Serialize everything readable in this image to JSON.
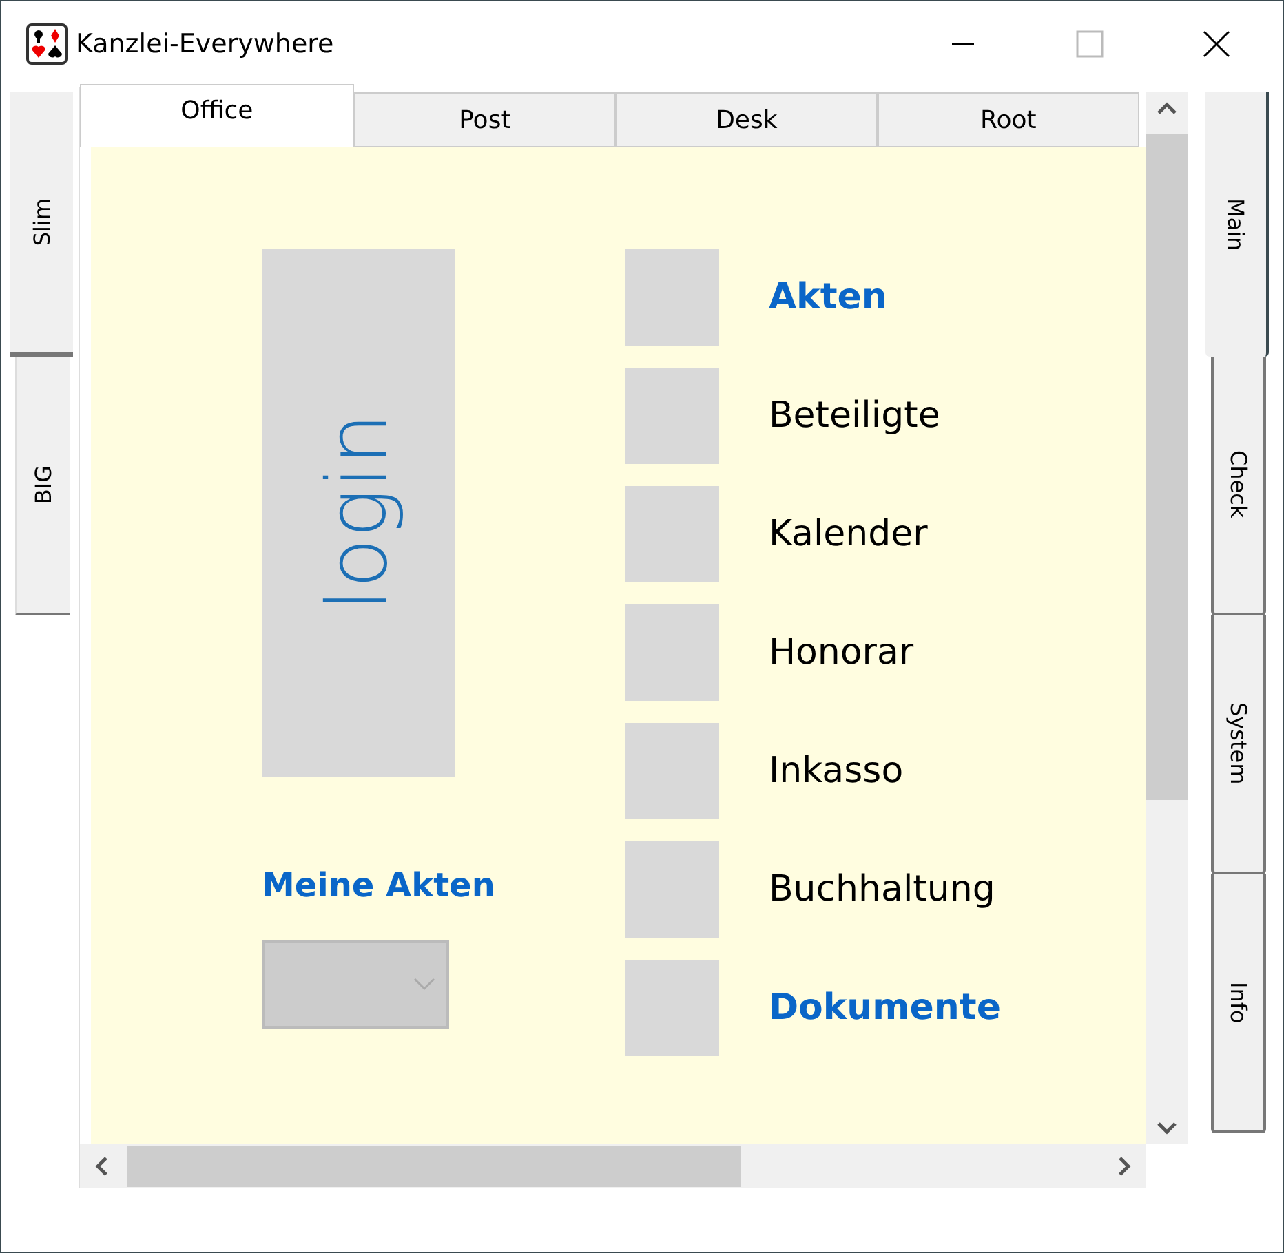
{
  "window": {
    "title": "Kanzlei-Everywhere"
  },
  "left_tabs": [
    {
      "label": "Slim",
      "selected": true
    },
    {
      "label": "BIG",
      "selected": false
    }
  ],
  "right_tabs": [
    {
      "label": "Main",
      "selected": true
    },
    {
      "label": "Check",
      "selected": false
    },
    {
      "label": "System",
      "selected": false
    },
    {
      "label": "Info",
      "selected": false
    }
  ],
  "tabs": [
    {
      "label": "Office",
      "selected": true
    },
    {
      "label": "Post",
      "selected": false
    },
    {
      "label": "Desk",
      "selected": false
    },
    {
      "label": "Root",
      "selected": false
    }
  ],
  "login_button": {
    "label": "login"
  },
  "my_files": {
    "label": "Meine Akten",
    "dropdown": {
      "disabled": true
    }
  },
  "menu": [
    {
      "label": "Akten",
      "highlighted": true
    },
    {
      "label": "Beteiligte",
      "highlighted": false
    },
    {
      "label": "Kalender",
      "highlighted": false
    },
    {
      "label": "Honorar",
      "highlighted": false
    },
    {
      "label": "Inkasso",
      "highlighted": false
    },
    {
      "label": "Buchhaltung",
      "highlighted": false
    },
    {
      "label": "Dokumente",
      "highlighted": true
    }
  ]
}
